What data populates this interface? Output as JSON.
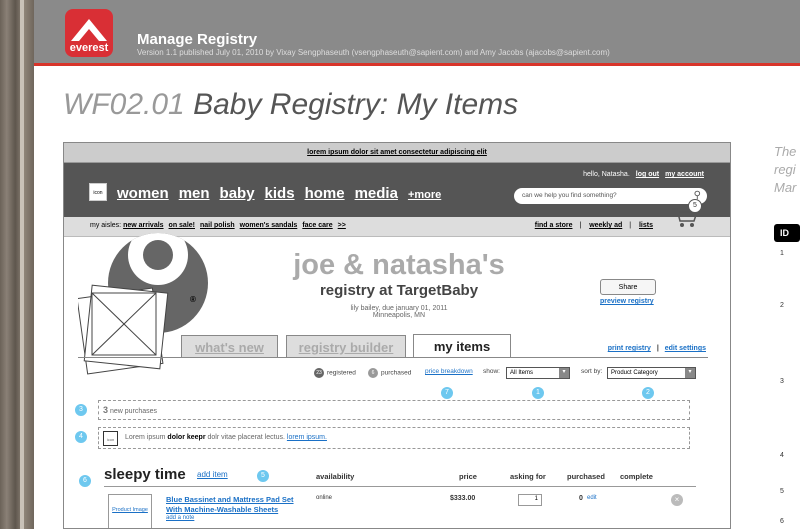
{
  "header": {
    "logo_text": "everest",
    "title": "Manage Registry",
    "subtitle": "Version 1.1 published July 01, 2010  by Vixay Sengphaseuth (vsengphaseuth@sapient.com) and Amy Jacobs (ajacobs@sapient.com)"
  },
  "page": {
    "number": "WF02.01",
    "title": "Baby Registry: My Items"
  },
  "side": {
    "line1": "The",
    "line2": "regi",
    "line3": "Mar",
    "col_id": "ID",
    "row_nums": [
      "1",
      "2",
      "3",
      "4",
      "5",
      "6"
    ]
  },
  "promo": "lorem ipsum dolor sit amet consectetur adipiscing elit",
  "topnav": {
    "hello": "hello, Natasha.",
    "logout": "log out",
    "account": "my account",
    "icon_label": "icon",
    "links": [
      "women",
      "men",
      "baby",
      "kids",
      "home",
      "media",
      "+more"
    ],
    "search_placeholder": "can we help you find something?"
  },
  "aisles": {
    "label": "my aisles:",
    "items": [
      "new arrivals",
      "on sale!",
      "nail polish",
      "women's sandals",
      "face care",
      ">>"
    ],
    "right": [
      "find a store",
      "weekly ad",
      "lists"
    ],
    "cart_count": "5"
  },
  "registry": {
    "names": "joe & natasha's",
    "subtitle": "registry at TargetBaby",
    "due": "lily bailey, due january 01, 2011",
    "location": "Minneapolis, MN",
    "share": "Share",
    "preview": "preview registry",
    "registered_mark": "®"
  },
  "tabs": [
    "what's new",
    "registry builder",
    "my items"
  ],
  "links": {
    "print": "print registry",
    "sep": "|",
    "edit": "edit settings"
  },
  "filters": {
    "registered_count": "23",
    "registered": "registered",
    "purchased_count": "6",
    "purchased": "purchased",
    "breakdown": "price breakdown",
    "show_label": "show:",
    "show_value": "All Items",
    "sort_label": "sort by:",
    "sort_value": "Product Category",
    "badges": [
      "7",
      "1",
      "2"
    ]
  },
  "new_purchases": {
    "count": "3",
    "text": "new purchases",
    "badge": "3"
  },
  "notice": {
    "icon": "icon",
    "pre": "Lorem ipsum",
    "bold": "dolor keepr",
    "post": "dolr vitae placerat lectus.",
    "link": "lorem ipsum.",
    "badge": "4"
  },
  "section": {
    "title": "sleepy time",
    "add": "add item",
    "badge1": "5",
    "badge2": "6",
    "headers": [
      "availability",
      "price",
      "asking for",
      "purchased",
      "complete"
    ]
  },
  "product": {
    "image": "Product Image",
    "name_line1": "Blue Bassinet and Mattress Pad Set",
    "name_line2": "With Machine-Washable Sheets",
    "note": "add a note",
    "availability": "online",
    "price": "$333.00",
    "asking": "1",
    "purchased": "0",
    "edit": "edit",
    "remove": "×"
  }
}
